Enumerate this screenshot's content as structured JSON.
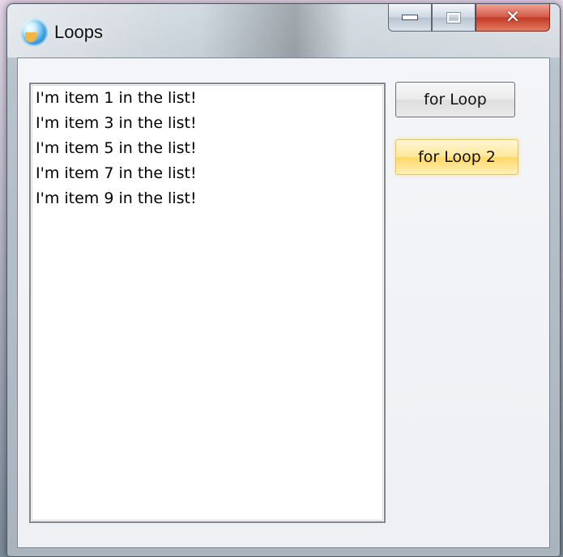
{
  "window": {
    "title": "Loops",
    "icon": "app-globe-icon",
    "controls": {
      "minimize": "minimize-icon",
      "maximize": "maximize-icon",
      "close": "close-icon"
    }
  },
  "listbox": {
    "items": [
      "I'm item 1 in the list!",
      "I'm item 3 in the list!",
      "I'm item 5 in the list!",
      "I'm item 7 in the list!",
      "I'm item 9 in the list!"
    ]
  },
  "buttons": {
    "for_loop": "for Loop",
    "for_loop_2": "for Loop 2"
  },
  "colors": {
    "hover_button": "#ffe89a",
    "close_button": "#c23b26"
  }
}
